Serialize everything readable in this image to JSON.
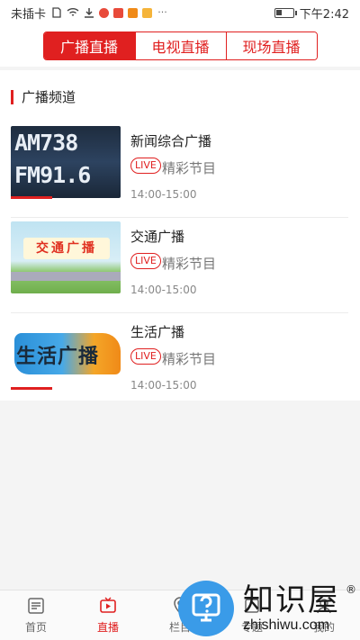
{
  "status_bar": {
    "carrier": "未插卡",
    "time": "下午2:42",
    "battery_level": 0.35,
    "app_icon_colors": [
      "#e84a3a",
      "#e84a3a",
      "#f08a18",
      "#f5b43a"
    ]
  },
  "top_tabs": [
    {
      "label": "广播直播",
      "active": true
    },
    {
      "label": "电视直播",
      "active": false
    },
    {
      "label": "现场直播",
      "active": false
    }
  ],
  "section": {
    "title": "广播频道"
  },
  "channels": [
    {
      "name": "新闻综合广播",
      "badge": "LIVE",
      "program": "精彩节目",
      "time": "14:00-15:00",
      "thumb_text": [
        "AM738",
        "FM91.6"
      ]
    },
    {
      "name": "交通广播",
      "badge": "LIVE",
      "program": "精彩节目",
      "time": "14:00-15:00",
      "thumb_text": [
        "交通广播"
      ]
    },
    {
      "name": "生活广播",
      "badge": "LIVE",
      "program": "精彩节目",
      "time": "14:00-15:00",
      "thumb_text": [
        "生活广播"
      ]
    }
  ],
  "bottom_tabs": [
    {
      "label": "首页",
      "icon": "news-icon",
      "active": false
    },
    {
      "label": "直播",
      "icon": "live-video-icon",
      "active": true
    },
    {
      "label": "栏目",
      "icon": "location-icon",
      "active": false
    },
    {
      "label": "专题",
      "icon": "topic-icon",
      "active": false
    },
    {
      "label": "我的",
      "icon": "user-icon",
      "active": false
    }
  ],
  "watermark": {
    "cn": "知识屋",
    "en": "zhishiwu.com",
    "mark": "®",
    "icon": "question-monitor-icon"
  },
  "colors": {
    "accent": "#e02020",
    "watermark_blue": "#3a9be8"
  }
}
